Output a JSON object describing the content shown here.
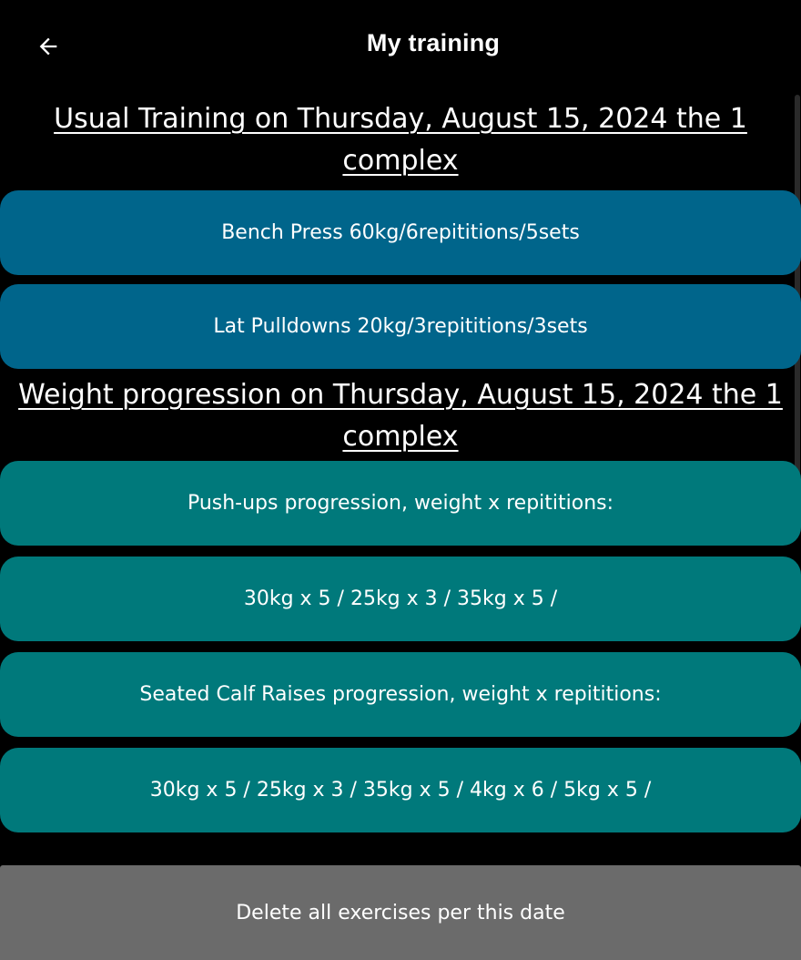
{
  "app_bar": {
    "title": "My training",
    "back_icon": "arrow-left-icon"
  },
  "usual_training": {
    "heading_line1": "Usual Training on Thursday, August 15, 2024 the 1",
    "heading_line2": "complex",
    "exercises": [
      "Bench Press 60kg/6repitition​s/5sets",
      "Lat Pulldowns 20kg/3repititions/3sets"
    ]
  },
  "weight_progression": {
    "heading_line1": "Weight progression on Thursday, August 15, 2024 the 1",
    "heading_line2": "complex",
    "items": [
      "Push-ups progression, weight x repititions:",
      "30kg x 5 / 25kg x 3 / 35kg x 5 /",
      "Seated Calf Raises progression, weight x repititions:",
      "30kg x 5 / 25kg x 3 / 35kg x 5 / 4kg x 6 / 5kg x 5 /"
    ]
  },
  "delete_button": {
    "label": "Delete all exercises per this date"
  },
  "colors": {
    "background": "#000000",
    "usual_card": "#00658b",
    "progression_card": "#00797b",
    "delete_bar": "#6b6b6b",
    "text": "#ffffff"
  }
}
